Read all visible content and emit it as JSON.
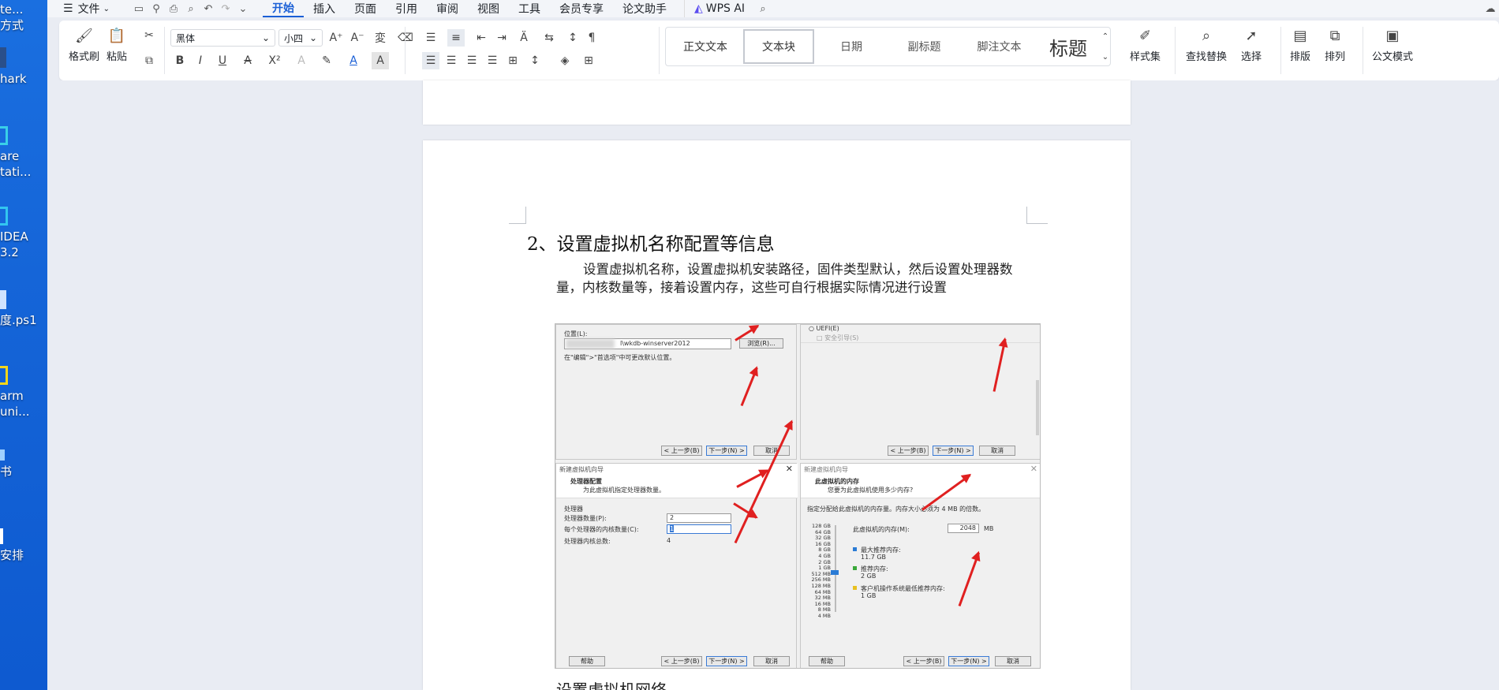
{
  "desktop": {
    "icons": [
      {
        "label": "te...",
        "label2": "方式"
      },
      {
        "label": "hark",
        "label2": ""
      },
      {
        "label": "are",
        "label2": "tati..."
      },
      {
        "label": "IDEA",
        "label2": "3.2"
      },
      {
        "label": "度.ps1",
        "label2": ""
      },
      {
        "label": "arm",
        "label2": "uni..."
      },
      {
        "label": "书",
        "label2": ""
      },
      {
        "label": "安排",
        "label2": ""
      }
    ]
  },
  "titlebar": {
    "file_menu": "文件",
    "tabs": [
      "开始",
      "插入",
      "页面",
      "引用",
      "审阅",
      "视图",
      "工具",
      "会员专享",
      "论文助手"
    ],
    "active_tab": "开始",
    "wps_ai": "WPS AI"
  },
  "ribbon": {
    "format_painter": "格式刷",
    "paste": "粘贴",
    "font_name": "黑体",
    "font_size": "小四",
    "bold": "B",
    "italic": "I",
    "underline": "U",
    "styles": [
      "正文文本",
      "文本块",
      "日期",
      "副标题",
      "脚注文本",
      "标题"
    ],
    "active_style": "文本块",
    "style_set": "样式集",
    "find_replace": "查找替换",
    "select": "选择",
    "layout": "排版",
    "arrange": "排列",
    "official_mode": "公文模式"
  },
  "document": {
    "heading": "2、设置虚拟机名称配置等信息",
    "paragraph": "设置虚拟机名称，设置虚拟机安装路径，固件类型默认，然后设置处理器数量，内核数量等，接着设置内存，这些可自行根据实际情况进行设置",
    "next_heading_partial": "设置虚拟机网络 ……"
  },
  "figure": {
    "tl": {
      "location_label": "位置(L):",
      "path": "l\\wkdb-winserver2012",
      "browse": "浏览(R)...",
      "hint": "在\"编辑\">\"首选项\"中可更改默认位置。",
      "back": "< 上一步(B)",
      "next": "下一步(N) >",
      "cancel": "取消"
    },
    "tr": {
      "uefi": "UEFI(E)",
      "secure_boot": "安全引导(S)",
      "back": "< 上一步(B)",
      "next": "下一步(N) >",
      "cancel": "取消"
    },
    "bl": {
      "window_title": "新建虚拟机向导",
      "title": "处理器配置",
      "subtitle": "为此虚拟机指定处理器数量。",
      "group": "处理器",
      "cpu_count_label": "处理器数量(P):",
      "cpu_count": "2",
      "cores_label": "每个处理器的内核数量(C):",
      "cores": "1",
      "total_label": "处理器内核总数:",
      "total": "4",
      "help": "帮助",
      "back": "< 上一步(B)",
      "next": "下一步(N) >",
      "cancel": "取消"
    },
    "br": {
      "window_title": "新建虚拟机向导",
      "title": "此虚拟机的内存",
      "subtitle": "您要为此虚拟机使用多少内存?",
      "hint": "指定分配给此虚拟机的内存量。内存大小必须为 4 MB 的倍数。",
      "memory_label": "此虚拟机的内存(M):",
      "memory_value": "2048",
      "memory_unit": "MB",
      "scale": [
        "128 GB",
        "64 GB",
        "32 GB",
        "16 GB",
        "8 GB",
        "4 GB",
        "2 GB",
        "1 GB",
        "512 MB",
        "256 MB",
        "128 MB",
        "64 MB",
        "32 MB",
        "16 MB",
        "8 MB",
        "4 MB"
      ],
      "max_label": "最大推荐内存:",
      "max_value": "11.7 GB",
      "rec_label": "推荐内存:",
      "rec_value": "2 GB",
      "min_label": "客户机操作系统最低推荐内存:",
      "min_value": "1 GB",
      "help": "帮助",
      "back": "< 上一步(B)",
      "next": "下一步(N) >",
      "cancel": "取消"
    }
  }
}
